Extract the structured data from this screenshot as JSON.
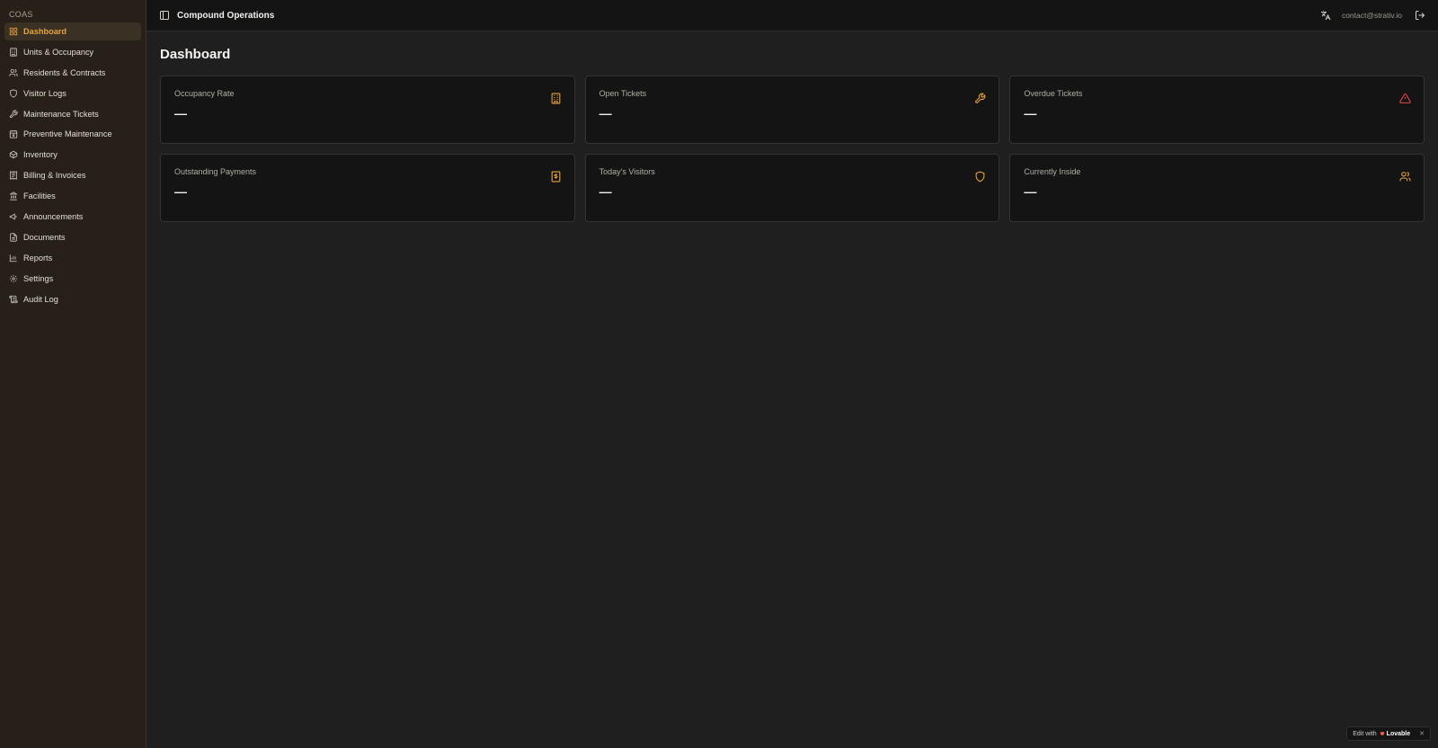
{
  "sidebar": {
    "brand": "COAS",
    "items": [
      {
        "label": "Dashboard",
        "icon": "layout-grid-icon",
        "active": true
      },
      {
        "label": "Units & Occupancy",
        "icon": "building-icon"
      },
      {
        "label": "Residents & Contracts",
        "icon": "users-icon"
      },
      {
        "label": "Visitor Logs",
        "icon": "shield-icon"
      },
      {
        "label": "Maintenance Tickets",
        "icon": "wrench-icon"
      },
      {
        "label": "Preventive Maintenance",
        "icon": "calendar-cog-icon"
      },
      {
        "label": "Inventory",
        "icon": "package-icon"
      },
      {
        "label": "Billing & Invoices",
        "icon": "receipt-icon"
      },
      {
        "label": "Facilities",
        "icon": "landmark-icon"
      },
      {
        "label": "Announcements",
        "icon": "megaphone-icon"
      },
      {
        "label": "Documents",
        "icon": "file-text-icon"
      },
      {
        "label": "Reports",
        "icon": "bar-chart-icon"
      },
      {
        "label": "Settings",
        "icon": "gear-icon"
      },
      {
        "label": "Audit Log",
        "icon": "scroll-icon"
      }
    ]
  },
  "header": {
    "title": "Compound Operations",
    "email": "contact@strativ.io"
  },
  "main": {
    "page_title": "Dashboard",
    "cards": [
      {
        "label": "Occupancy Rate",
        "value": "—",
        "icon": "building-icon"
      },
      {
        "label": "Open Tickets",
        "value": "—",
        "icon": "wrench-icon"
      },
      {
        "label": "Overdue Tickets",
        "value": "—",
        "icon": "alert-triangle-icon"
      },
      {
        "label": "Outstanding Payments",
        "value": "—",
        "icon": "receipt-dollar-icon"
      },
      {
        "label": "Today's Visitors",
        "value": "—",
        "icon": "shield-icon"
      },
      {
        "label": "Currently Inside",
        "value": "—",
        "icon": "users-icon"
      }
    ]
  },
  "badge": {
    "prefix": "Edit with",
    "brand": "Lovable",
    "close": "✕"
  },
  "colors": {
    "accent": "#e8a43a",
    "danger": "#e5484d",
    "sidebar_bg": "#272018",
    "card_bg": "#141414"
  }
}
